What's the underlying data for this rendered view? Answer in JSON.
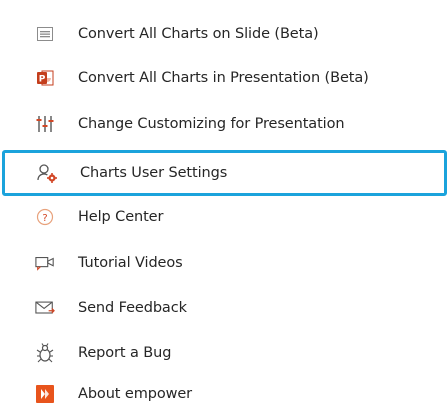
{
  "menu": {
    "items": [
      {
        "id": "convert-slide",
        "label": "Convert All Charts on Slide (Beta)",
        "icon": "chart-slide-icon"
      },
      {
        "id": "convert-presentation",
        "label": "Convert All Charts in Presentation (Beta)",
        "icon": "powerpoint-icon"
      },
      {
        "id": "change-customizing",
        "label": "Change Customizing for Presentation",
        "icon": "sliders-icon"
      },
      {
        "id": "charts-user-settings",
        "label": "Charts User Settings",
        "icon": "user-settings-icon",
        "highlighted": true
      },
      {
        "id": "help-center",
        "label": "Help Center",
        "icon": "help-icon"
      },
      {
        "id": "tutorial-videos",
        "label": "Tutorial Videos",
        "icon": "video-icon"
      },
      {
        "id": "send-feedback",
        "label": "Send Feedback",
        "icon": "mail-icon"
      },
      {
        "id": "report-bug",
        "label": "Report a Bug",
        "icon": "bug-icon"
      },
      {
        "id": "about-empower",
        "label": "About empower",
        "icon": "empower-logo-icon"
      }
    ]
  },
  "colors": {
    "highlight_border": "#1ba3dc",
    "text": "#262626",
    "powerpoint_red": "#c43e1c",
    "empower_orange": "#e8541c",
    "settings_orange": "#d24726",
    "icon_gray": "#6b6b6b"
  }
}
